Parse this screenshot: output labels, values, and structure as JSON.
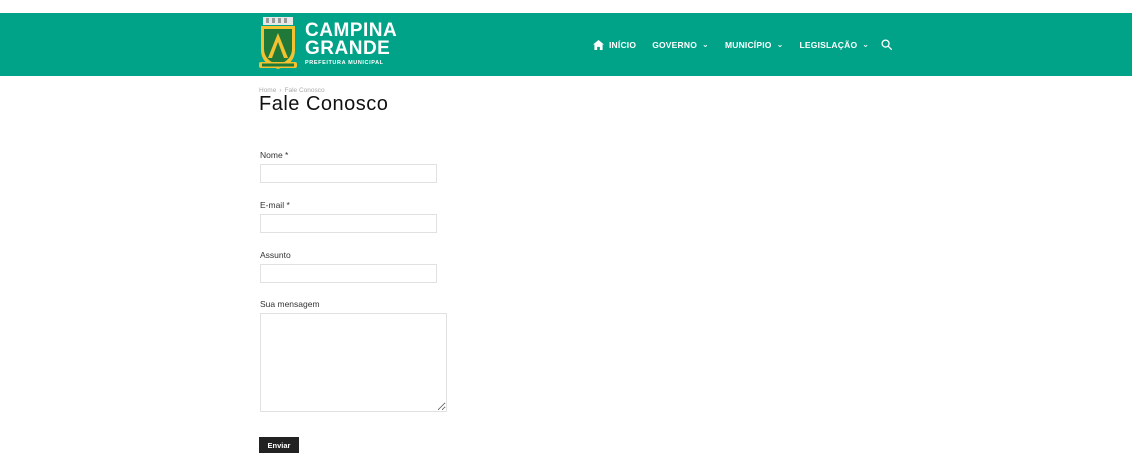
{
  "brand": {
    "line1": "CAMPINA",
    "line2": "GRANDE",
    "subtitle": "PREFEITURA MUNICIPAL",
    "primary_color": "#00a388"
  },
  "nav": {
    "items": [
      {
        "label": "INÍCIO",
        "icon": "home-icon"
      },
      {
        "label": "GOVERNO",
        "icon": "chevron-down-icon"
      },
      {
        "label": "MUNICÍPIO",
        "icon": "chevron-down-icon"
      },
      {
        "label": "LEGISLAÇÃO",
        "icon": "chevron-down-icon"
      }
    ],
    "search_icon": "search-icon"
  },
  "breadcrumb": {
    "home": "Home",
    "separator": "›",
    "current": "Fale Conosco"
  },
  "page": {
    "title": "Fale Conosco"
  },
  "form": {
    "name_label": "Nome *",
    "name_value": "",
    "email_label": "E-mail *",
    "email_value": "",
    "subject_label": "Assunto",
    "subject_value": "",
    "message_label": "Sua mensagem",
    "message_value": "",
    "submit_label": "Enviar"
  }
}
